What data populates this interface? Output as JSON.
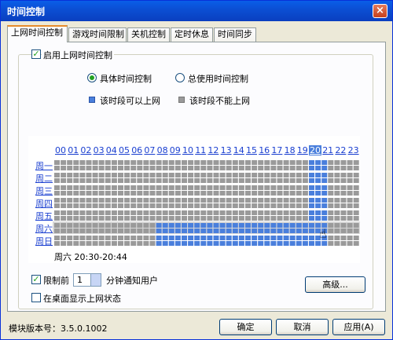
{
  "window": {
    "title": "时间控制",
    "close": "×"
  },
  "tabs": [
    "上网时间控制",
    "游戏时间限制",
    "关机控制",
    "定时休息",
    "时间同步"
  ],
  "enable": {
    "label": "启用上网时间控制",
    "checked": true
  },
  "modes": [
    {
      "label": "具体时间控制",
      "selected": true
    },
    {
      "label": "总使用时间控制",
      "selected": false
    }
  ],
  "legend": [
    {
      "label": "该时段可以上网",
      "color": "#4a7fdc"
    },
    {
      "label": "该时段不能上网",
      "color": "#9a9a9a"
    }
  ],
  "hours": [
    "00",
    "01",
    "02",
    "03",
    "04",
    "05",
    "06",
    "07",
    "08",
    "09",
    "10",
    "11",
    "12",
    "13",
    "14",
    "15",
    "16",
    "17",
    "18",
    "19",
    "20",
    "21",
    "22",
    "23"
  ],
  "highlight_hour": "20",
  "days": [
    "周一",
    "周二",
    "周三",
    "周四",
    "周五",
    "周六",
    "周日"
  ],
  "schedule_note": "blue = allowed (per half-hour slot), gray = blocked",
  "schedule": [
    [
      0,
      0,
      0,
      0,
      0,
      0,
      0,
      0,
      0,
      0,
      0,
      0,
      0,
      0,
      0,
      0,
      0,
      0,
      0,
      0,
      0,
      0,
      0,
      0,
      0,
      0,
      0,
      0,
      0,
      0,
      0,
      0,
      0,
      0,
      0,
      0,
      0,
      0,
      0,
      0,
      1,
      1,
      1,
      0,
      0,
      0,
      0,
      0
    ],
    [
      0,
      0,
      0,
      0,
      0,
      0,
      0,
      0,
      0,
      0,
      0,
      0,
      0,
      0,
      0,
      0,
      0,
      0,
      0,
      0,
      0,
      0,
      0,
      0,
      0,
      0,
      0,
      0,
      0,
      0,
      0,
      0,
      0,
      0,
      0,
      0,
      0,
      0,
      0,
      0,
      1,
      1,
      1,
      0,
      0,
      0,
      0,
      0
    ],
    [
      0,
      0,
      0,
      0,
      0,
      0,
      0,
      0,
      0,
      0,
      0,
      0,
      0,
      0,
      0,
      0,
      0,
      0,
      0,
      0,
      0,
      0,
      0,
      0,
      0,
      0,
      0,
      0,
      0,
      0,
      0,
      0,
      0,
      0,
      0,
      0,
      0,
      0,
      0,
      0,
      1,
      1,
      1,
      0,
      0,
      0,
      0,
      0
    ],
    [
      0,
      0,
      0,
      0,
      0,
      0,
      0,
      0,
      0,
      0,
      0,
      0,
      0,
      0,
      0,
      0,
      0,
      0,
      0,
      0,
      0,
      0,
      0,
      0,
      0,
      0,
      0,
      0,
      0,
      0,
      0,
      0,
      0,
      0,
      0,
      0,
      0,
      0,
      0,
      0,
      1,
      1,
      1,
      0,
      0,
      0,
      0,
      0
    ],
    [
      0,
      0,
      0,
      0,
      0,
      0,
      0,
      0,
      0,
      0,
      0,
      0,
      0,
      0,
      0,
      0,
      0,
      0,
      0,
      0,
      0,
      0,
      0,
      0,
      0,
      0,
      0,
      0,
      0,
      0,
      0,
      0,
      0,
      0,
      0,
      0,
      0,
      0,
      0,
      0,
      1,
      1,
      1,
      0,
      0,
      0,
      0,
      0
    ],
    [
      0,
      0,
      0,
      0,
      0,
      0,
      0,
      0,
      0,
      0,
      0,
      0,
      0,
      0,
      0,
      0,
      1,
      1,
      1,
      1,
      1,
      1,
      1,
      1,
      1,
      1,
      1,
      1,
      1,
      1,
      1,
      1,
      1,
      1,
      1,
      1,
      1,
      1,
      1,
      1,
      1,
      1,
      1,
      0,
      0,
      0,
      0,
      0
    ],
    [
      0,
      0,
      0,
      0,
      0,
      0,
      0,
      0,
      0,
      0,
      0,
      0,
      0,
      0,
      0,
      0,
      1,
      1,
      1,
      1,
      1,
      1,
      1,
      1,
      1,
      1,
      1,
      1,
      1,
      1,
      1,
      1,
      1,
      1,
      1,
      1,
      1,
      1,
      1,
      1,
      1,
      1,
      1,
      0,
      0,
      0,
      0,
      0
    ]
  ],
  "hover_row": 5,
  "selection_info": "周六 20:30-20:44",
  "notify": {
    "label_before": "限制前",
    "value": "1",
    "label_after": "分钟通知用户",
    "checked": true
  },
  "desktop": {
    "label": "在桌面显示上网状态",
    "checked": false
  },
  "buttons": {
    "advanced": "高级...",
    "ok": "确定",
    "cancel": "取消",
    "apply": "应用(A)"
  },
  "version": "模块版本号：3.5.0.1002"
}
